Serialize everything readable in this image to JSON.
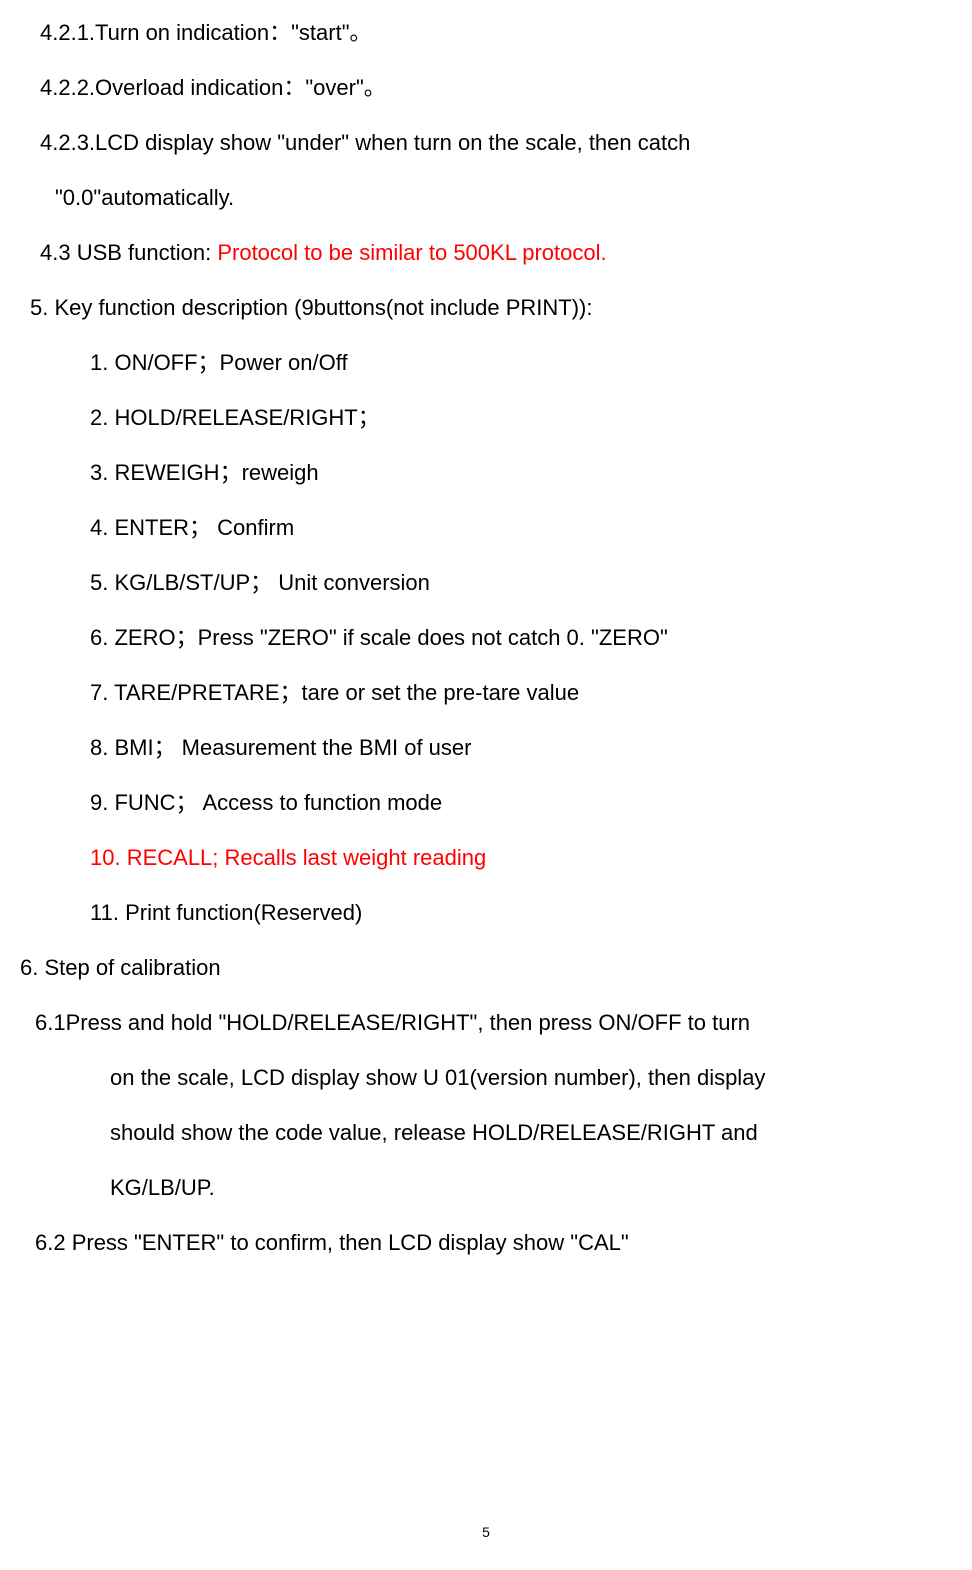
{
  "line1": "4.2.1.Turn on indication：\"start\"。",
  "line2": "4.2.2.Overload indication：\"over\"。",
  "line3a": "4.2.3.LCD display show \"under\" when turn on the scale, then catch",
  "line3b": "\"0.0\"automatically.",
  "line4_prefix": "4.3 USB function: ",
  "line4_red": "Protocol to be similar to 500KL protocol.",
  "line5": "5. Key function description (9buttons(not include PRINT)):",
  "key1": "1. ON/OFF；Power on/Off",
  "key2": "2. HOLD/RELEASE/RIGHT；",
  "key3": "3. REWEIGH；reweigh",
  "key4": "4. ENTER； Confirm",
  "key5": "5. KG/LB/ST/UP；  Unit conversion",
  "key6": "6. ZERO；Press \"ZERO\" if scale does not catch 0. \"ZERO\"",
  "key7": "7. TARE/PRETARE；tare or set the pre-tare value",
  "key8": "8. BMI；  Measurement the BMI of user",
  "key9": "9. FUNC；  Access to function mode",
  "key10": "10.  RECALL; Recalls last weight reading",
  "key11": "11.  Print function(Reserved)",
  "line6": "6. Step of calibration",
  "line61a": "6.1Press and hold \"HOLD/RELEASE/RIGHT\", then press ON/OFF to turn",
  "line61b": "on the scale, LCD display show U 01(version number), then display",
  "line61c": "should show the code value, release HOLD/RELEASE/RIGHT and",
  "line61d": "KG/LB/UP.",
  "line62": "6.2 Press \"ENTER\" to confirm, then LCD display show \"CAL\"",
  "pageNum": "5"
}
